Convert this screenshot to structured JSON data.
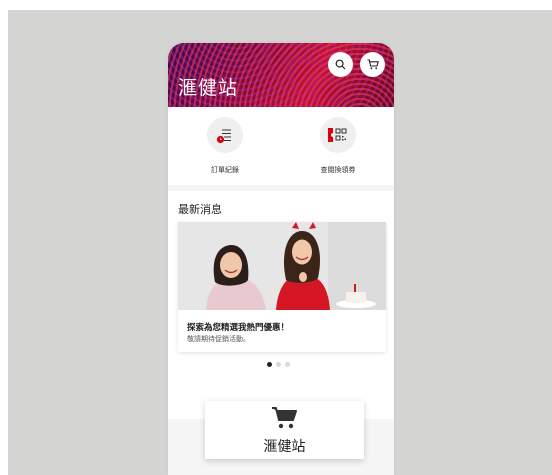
{
  "app": {
    "title": "滙健站"
  },
  "header": {
    "search_icon": "search-icon",
    "cart_icon": "cart-icon"
  },
  "quick_actions": [
    {
      "label": "訂單紀錄",
      "icon": "order-record-icon"
    },
    {
      "label": "查閱換領券",
      "icon": "voucher-qr-icon"
    }
  ],
  "news": {
    "heading": "最新消息",
    "promo": {
      "title": "探索為您精選我熱門優惠！",
      "subtitle": "敬請期待促銷活動。"
    },
    "dots": {
      "count": 3,
      "active_index": 0
    }
  },
  "floating_card": {
    "label": "滙健站",
    "icon": "cart-icon"
  },
  "colors": {
    "brand_red": "#db0011",
    "backdrop": "#d4d4d3"
  }
}
